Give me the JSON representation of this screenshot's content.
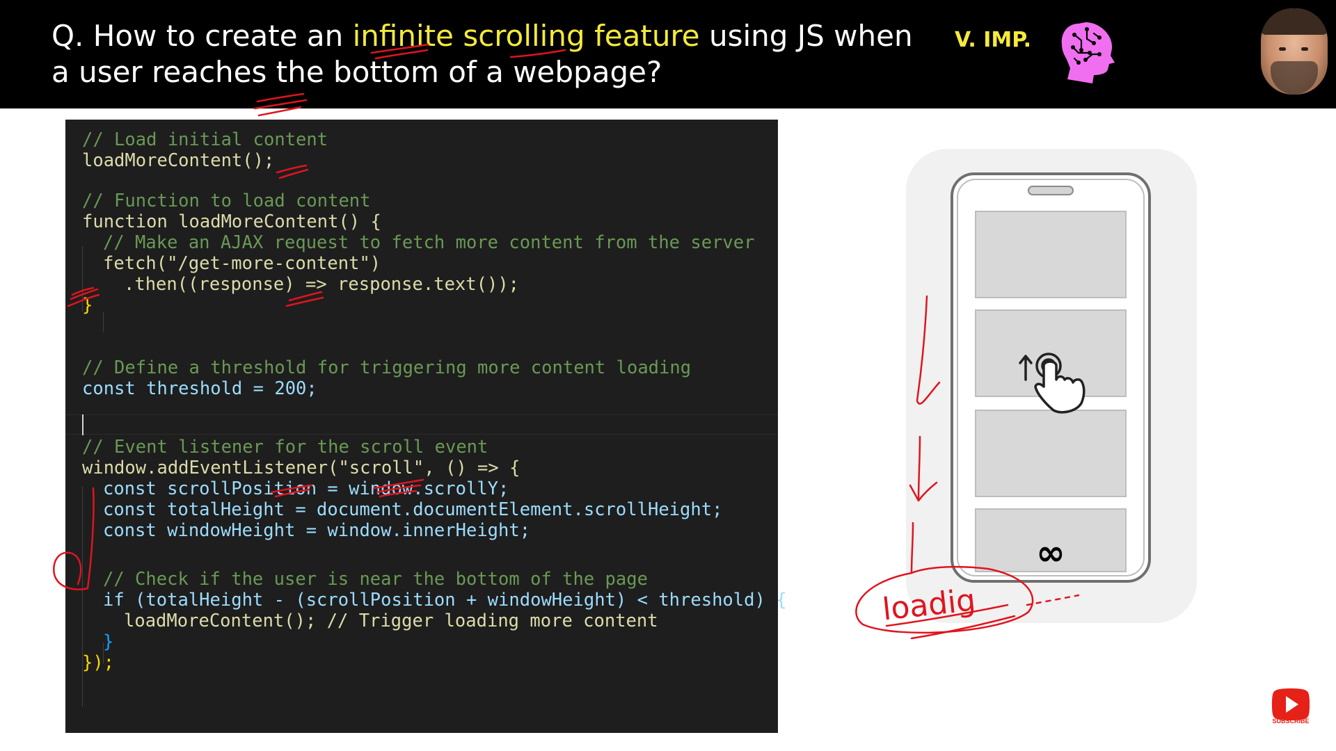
{
  "header": {
    "question_prefix": "Q. How to create an ",
    "question_highlight": "infinite scrolling feature",
    "question_suffix": " using JS when a user reaches the bottom of a webpage?",
    "importance_badge": "V. IMP.",
    "brain_icon": "brain-circuit-icon",
    "presenter_avatar": "presenter-avatar"
  },
  "code": {
    "lines": [
      "// Load initial content",
      "loadMoreContent();",
      "// Function to load content",
      "function loadMoreContent() {",
      "// Make an AJAX request to fetch more content from the server",
      "fetch(\"/get-more-content\")",
      ".then((response) => response.text());",
      "}",
      "// Define a threshold for triggering more content loading",
      "const threshold = 200;",
      "// Event listener for the scroll event",
      "window.addEventListener(\"scroll\", () => {",
      "const scrollPosition = window.scrollY;",
      "const totalHeight = document.documentElement.scrollHeight;",
      "const windowHeight = window.innerHeight;",
      "// Check if the user is near the bottom of the page",
      "if (totalHeight - (scrollPosition + windowHeight) < threshold) {",
      "loadMoreContent(); // Trigger loading more content",
      "}",
      "});"
    ]
  },
  "phone": {
    "infinity_symbol": "∞",
    "scroll_icon": "scroll-up-hand-icon",
    "handwritten_note": "loadig"
  },
  "youtube": {
    "subscribe_label": "SUBSCRIBE",
    "icon": "youtube-play-icon"
  },
  "colors": {
    "header_bg": "#000000",
    "highlight": "#f4ea3a",
    "code_bg": "#1e1e1e",
    "annotation_red": "#e0141e",
    "brain_pink": "#f06ff0"
  }
}
